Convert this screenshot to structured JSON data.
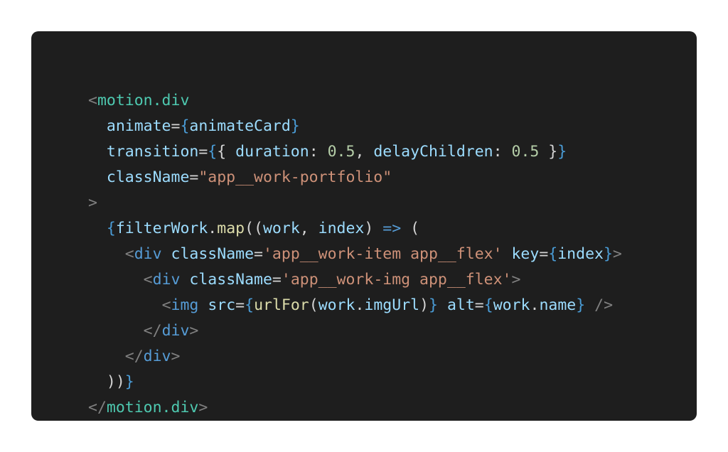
{
  "colors": {
    "background": "#1e1e1e",
    "punctuation": "#808080",
    "component_tag": "#4ec9b0",
    "html_tag": "#569cd6",
    "attribute": "#9cdcfe",
    "brace": "#4a9cd6",
    "string": "#ce9178",
    "number": "#b5cea8",
    "function": "#dcdcaa",
    "plain": "#d4d4d4"
  },
  "code": {
    "lines": [
      [
        {
          "t": "<",
          "c": "punctuation"
        },
        {
          "t": "motion.div",
          "c": "component_tag"
        }
      ],
      [
        {
          "t": "  "
        },
        {
          "t": "animate",
          "c": "attribute"
        },
        {
          "t": "=",
          "c": "plain"
        },
        {
          "t": "{",
          "c": "brace"
        },
        {
          "t": "animateCard",
          "c": "attribute"
        },
        {
          "t": "}",
          "c": "brace"
        }
      ],
      [
        {
          "t": "  "
        },
        {
          "t": "transition",
          "c": "attribute"
        },
        {
          "t": "=",
          "c": "plain"
        },
        {
          "t": "{",
          "c": "brace"
        },
        {
          "t": "{ ",
          "c": "plain"
        },
        {
          "t": "duration",
          "c": "attribute"
        },
        {
          "t": ": ",
          "c": "plain"
        },
        {
          "t": "0.5",
          "c": "number"
        },
        {
          "t": ", ",
          "c": "plain"
        },
        {
          "t": "delayChildren",
          "c": "attribute"
        },
        {
          "t": ": ",
          "c": "plain"
        },
        {
          "t": "0.5",
          "c": "number"
        },
        {
          "t": " }",
          "c": "plain"
        },
        {
          "t": "}",
          "c": "brace"
        }
      ],
      [
        {
          "t": "  "
        },
        {
          "t": "className",
          "c": "attribute"
        },
        {
          "t": "=",
          "c": "plain"
        },
        {
          "t": "\"app__work-portfolio\"",
          "c": "string"
        }
      ],
      [
        {
          "t": ">",
          "c": "punctuation"
        }
      ],
      [
        {
          "t": "  "
        },
        {
          "t": "{",
          "c": "brace"
        },
        {
          "t": "filterWork",
          "c": "attribute"
        },
        {
          "t": ".",
          "c": "plain"
        },
        {
          "t": "map",
          "c": "function"
        },
        {
          "t": "((",
          "c": "plain"
        },
        {
          "t": "work",
          "c": "attribute"
        },
        {
          "t": ", ",
          "c": "plain"
        },
        {
          "t": "index",
          "c": "attribute"
        },
        {
          "t": ") ",
          "c": "plain"
        },
        {
          "t": "=>",
          "c": "html_tag"
        },
        {
          "t": " (",
          "c": "plain"
        }
      ],
      [
        {
          "t": "    "
        },
        {
          "t": "<",
          "c": "punctuation"
        },
        {
          "t": "div",
          "c": "html_tag"
        },
        {
          "t": " "
        },
        {
          "t": "className",
          "c": "attribute"
        },
        {
          "t": "=",
          "c": "plain"
        },
        {
          "t": "'app__work-item app__flex'",
          "c": "string"
        },
        {
          "t": " "
        },
        {
          "t": "key",
          "c": "attribute"
        },
        {
          "t": "=",
          "c": "plain"
        },
        {
          "t": "{",
          "c": "brace"
        },
        {
          "t": "index",
          "c": "attribute"
        },
        {
          "t": "}",
          "c": "brace"
        },
        {
          "t": ">",
          "c": "punctuation"
        }
      ],
      [
        {
          "t": "      "
        },
        {
          "t": "<",
          "c": "punctuation"
        },
        {
          "t": "div",
          "c": "html_tag"
        },
        {
          "t": " "
        },
        {
          "t": "className",
          "c": "attribute"
        },
        {
          "t": "=",
          "c": "plain"
        },
        {
          "t": "'app__work-img app__flex'",
          "c": "string"
        },
        {
          "t": ">",
          "c": "punctuation"
        }
      ],
      [
        {
          "t": "        "
        },
        {
          "t": "<",
          "c": "punctuation"
        },
        {
          "t": "img",
          "c": "html_tag"
        },
        {
          "t": " "
        },
        {
          "t": "src",
          "c": "attribute"
        },
        {
          "t": "=",
          "c": "plain"
        },
        {
          "t": "{",
          "c": "brace"
        },
        {
          "t": "urlFor",
          "c": "function"
        },
        {
          "t": "(",
          "c": "plain"
        },
        {
          "t": "work",
          "c": "attribute"
        },
        {
          "t": ".",
          "c": "plain"
        },
        {
          "t": "imgUrl",
          "c": "attribute"
        },
        {
          "t": ")",
          "c": "plain"
        },
        {
          "t": "}",
          "c": "brace"
        },
        {
          "t": " "
        },
        {
          "t": "alt",
          "c": "attribute"
        },
        {
          "t": "=",
          "c": "plain"
        },
        {
          "t": "{",
          "c": "brace"
        },
        {
          "t": "work",
          "c": "attribute"
        },
        {
          "t": ".",
          "c": "plain"
        },
        {
          "t": "name",
          "c": "attribute"
        },
        {
          "t": "}",
          "c": "brace"
        },
        {
          "t": " "
        },
        {
          "t": "/>",
          "c": "punctuation"
        }
      ],
      [
        {
          "t": "      "
        },
        {
          "t": "</",
          "c": "punctuation"
        },
        {
          "t": "div",
          "c": "html_tag"
        },
        {
          "t": ">",
          "c": "punctuation"
        }
      ],
      [
        {
          "t": "    "
        },
        {
          "t": "</",
          "c": "punctuation"
        },
        {
          "t": "div",
          "c": "html_tag"
        },
        {
          "t": ">",
          "c": "punctuation"
        }
      ],
      [
        {
          "t": "  "
        },
        {
          "t": "))",
          "c": "plain"
        },
        {
          "t": "}",
          "c": "brace"
        }
      ],
      [
        {
          "t": "</",
          "c": "punctuation"
        },
        {
          "t": "motion.div",
          "c": "component_tag"
        },
        {
          "t": ">",
          "c": "punctuation"
        }
      ]
    ]
  }
}
